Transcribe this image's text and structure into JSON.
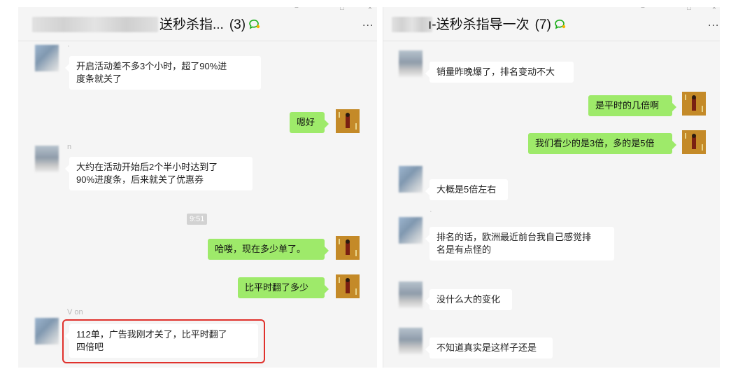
{
  "left_window": {
    "title": "送秒杀指...",
    "member_count": "(3)",
    "more_label": "...",
    "window_controls": [
      "−",
      "□",
      "×"
    ],
    "messages": [
      {
        "kind": "in",
        "sender": "·",
        "text": "开启活动差不多3个小时，超了90%进\n度条就关了"
      },
      {
        "kind": "out",
        "text": "嗯好"
      },
      {
        "kind": "in",
        "sender": "n",
        "text": "大约在活动开始后2个半小时达到了\n90%进度条，后来就关了优惠券"
      },
      {
        "kind": "time",
        "text": "9:51"
      },
      {
        "kind": "out",
        "text": "哈喽，现在多少单了。"
      },
      {
        "kind": "out",
        "text": "比平时翻了多少"
      },
      {
        "kind": "in",
        "sender": "V  on",
        "text": "112单，广告我刚才关了，比平时翻了\n四倍吧",
        "highlighted": true
      }
    ]
  },
  "right_window": {
    "title": "ı-送秒杀指导一次",
    "member_count": "(7)",
    "more_label": "...",
    "window_controls": [
      "−",
      "□",
      "×"
    ],
    "messages": [
      {
        "kind": "in",
        "sender": "",
        "text": "销量昨晚爆了，排名变动不大"
      },
      {
        "kind": "out",
        "text": "是平时的几倍啊"
      },
      {
        "kind": "out",
        "text": "我们看少的是3倍，多的是5倍"
      },
      {
        "kind": "in",
        "sender": "",
        "text": "大概是5倍左右"
      },
      {
        "kind": "in",
        "sender": "·",
        "text": "排名的话，欧洲最近前台我自己感觉排\n名是有点怪的"
      },
      {
        "kind": "in",
        "sender": "",
        "text": "没什么大的变化"
      },
      {
        "kind": "in",
        "sender": "",
        "text": "不知道真实是这样子还是"
      }
    ]
  },
  "colors": {
    "incoming_bubble": "#ffffff",
    "outgoing_bubble": "#9eea6a",
    "chat_background": "#f5f5f5",
    "highlight_border": "#e0312c",
    "group_chat_icon": "#1aad19"
  },
  "icons": [
    "group-chat-icon",
    "more-icon",
    "minimize-icon",
    "maximize-icon",
    "close-icon"
  ]
}
